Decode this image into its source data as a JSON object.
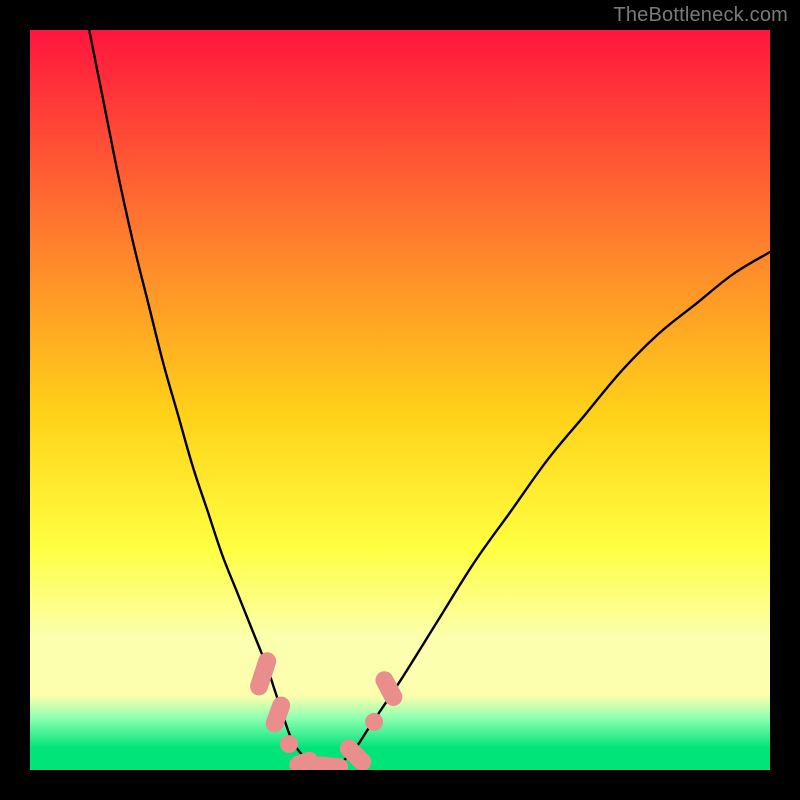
{
  "watermark": "TheBottleneck.com",
  "colors": {
    "frame": "#000000",
    "gradient_top": "#ff153e",
    "gradient_mid1": "#ff7d2e",
    "gradient_mid2": "#ffd219",
    "gradient_mid3": "#ffff41",
    "gradient_yellowband": "#fcffad",
    "gradient_green_light": "#8cffb0",
    "gradient_green": "#00e47a",
    "curve": "#000000",
    "marker_fill": "#e98d8d",
    "marker_stroke": "#c96e6e"
  },
  "chart_data": {
    "type": "line",
    "title": "",
    "xlabel": "",
    "ylabel": "",
    "xlim": [
      0,
      100
    ],
    "ylim": [
      0,
      100
    ],
    "series": [
      {
        "name": "bottleneck-curve",
        "x": [
          8,
          10,
          12,
          14,
          16,
          18,
          20,
          22,
          24,
          26,
          28,
          30,
          32,
          33,
          34,
          35,
          36,
          38,
          40,
          42,
          44,
          46,
          50,
          55,
          60,
          65,
          70,
          75,
          80,
          85,
          90,
          95,
          100
        ],
        "y": [
          100,
          90,
          80,
          71,
          63,
          55,
          48,
          41,
          35,
          29,
          24,
          19,
          14,
          11,
          8,
          5,
          3,
          1,
          0.5,
          1,
          3,
          6,
          12,
          20,
          28,
          35,
          42,
          48,
          54,
          59,
          63,
          67,
          70
        ]
      }
    ],
    "markers": [
      {
        "shape": "pill",
        "x": 31.5,
        "y": 13,
        "angle": -72,
        "len": 6
      },
      {
        "shape": "pill",
        "x": 33.5,
        "y": 7.5,
        "angle": -70,
        "len": 5
      },
      {
        "shape": "dot",
        "x": 35,
        "y": 3.5
      },
      {
        "shape": "pill",
        "x": 37,
        "y": 1,
        "angle": -20,
        "len": 4
      },
      {
        "shape": "pill",
        "x": 40.5,
        "y": 0.5,
        "angle": 5,
        "len": 5
      },
      {
        "shape": "pill",
        "x": 44,
        "y": 2,
        "angle": 45,
        "len": 5
      },
      {
        "shape": "dot",
        "x": 46.5,
        "y": 6.5
      },
      {
        "shape": "pill",
        "x": 48.5,
        "y": 11,
        "angle": 62,
        "len": 5
      }
    ]
  }
}
